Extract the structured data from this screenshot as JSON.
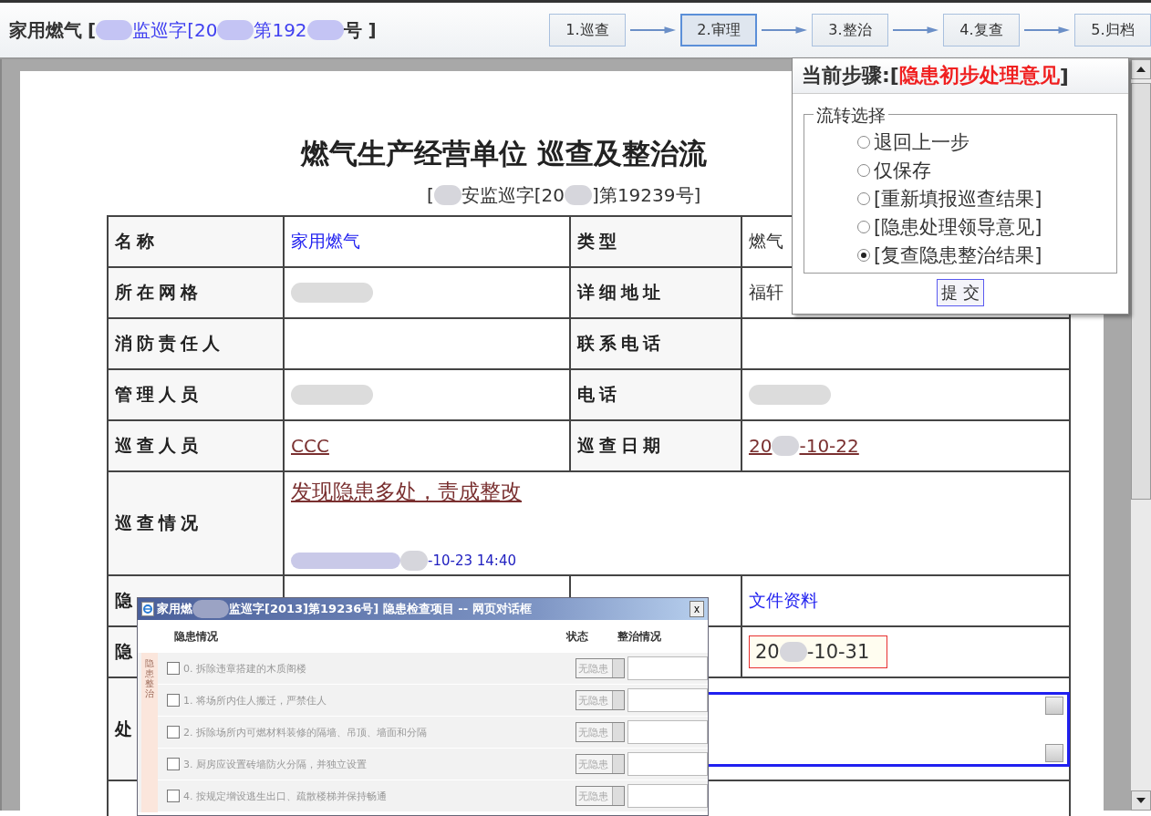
{
  "header": {
    "title": "家用燃气",
    "ref_parts": [
      "[",
      "监巡字[20",
      "第192",
      "号 ]"
    ]
  },
  "steps": [
    {
      "label": "1.巡查",
      "selected": false
    },
    {
      "label": "2.审理",
      "selected": true
    },
    {
      "label": "3.整治",
      "selected": false
    },
    {
      "label": "4.复查",
      "selected": false
    },
    {
      "label": "5.归档",
      "selected": false
    }
  ],
  "document": {
    "title": "燃气生产经营单位 巡查及整治流",
    "subtitle_parts": [
      "[",
      "安监巡字[20",
      "]第19239号]"
    ],
    "rows": [
      {
        "kind": "pair",
        "cells": [
          {
            "kind": "label",
            "text": "名称"
          },
          {
            "kind": "link",
            "text": "家用燃气"
          },
          {
            "kind": "label",
            "text": "类型"
          },
          {
            "kind": "plain",
            "text": "燃气"
          }
        ]
      },
      {
        "kind": "pair",
        "cells": [
          {
            "kind": "label",
            "text": "所在网格"
          },
          {
            "kind": "redacted"
          },
          {
            "kind": "label",
            "text": "详细地址"
          },
          {
            "kind": "plain",
            "text": "福轩"
          }
        ]
      },
      {
        "kind": "pair",
        "cells": [
          {
            "kind": "label",
            "text": "消防责任人"
          },
          {
            "kind": "empty"
          },
          {
            "kind": "label",
            "text": "联系电话"
          },
          {
            "kind": "empty"
          }
        ]
      },
      {
        "kind": "pair",
        "cells": [
          {
            "kind": "label",
            "text": "管理人员"
          },
          {
            "kind": "redacted"
          },
          {
            "kind": "label",
            "text": "电话"
          },
          {
            "kind": "redacted"
          }
        ]
      },
      {
        "kind": "pair",
        "cells": [
          {
            "kind": "label",
            "text": "巡查人员"
          },
          {
            "kind": "entry",
            "parts": [
              "CCC"
            ]
          },
          {
            "kind": "label",
            "text": "巡查日期"
          },
          {
            "kind": "entry",
            "parts": [
              "20",
              "-10-22"
            ]
          }
        ]
      },
      {
        "kind": "wide",
        "cells": [
          {
            "kind": "label",
            "text": "巡查情况"
          },
          {
            "kind": "note",
            "parts": [
              "发现隐患多处，责成整改"
            ],
            "stamp": "-10-23 14:40"
          }
        ]
      },
      {
        "kind": "pair",
        "cells": [
          {
            "kind": "label",
            "text": "隐"
          },
          {
            "kind": "empty"
          },
          {
            "kind": "empty"
          },
          {
            "kind": "link",
            "text": "文件资料"
          }
        ]
      },
      {
        "kind": "pair",
        "cells": [
          {
            "kind": "label",
            "text": "隐"
          },
          {
            "kind": "empty"
          },
          {
            "kind": "empty"
          },
          {
            "kind": "date-field",
            "parts": [
              "20",
              "-10-31"
            ]
          }
        ]
      },
      {
        "kind": "tall",
        "cells": [
          {
            "kind": "label",
            "text": "处"
          },
          {
            "kind": "textarea"
          }
        ]
      },
      {
        "kind": "wide",
        "cells": [
          {
            "kind": "empty"
          },
          {
            "kind": "empty"
          }
        ]
      }
    ]
  },
  "flow_panel": {
    "step_label": "当前步骤:[",
    "step_name": "隐患初步处理意见",
    "step_suffix": "]",
    "legend": "流转选择",
    "options": [
      {
        "label": "退回上一步",
        "selected": false
      },
      {
        "label": "仅保存",
        "selected": false
      },
      {
        "label": "[重新填报巡查结果]",
        "selected": false
      },
      {
        "label": "[隐患处理领导意见]",
        "selected": false
      },
      {
        "label": "[复查隐患整治结果]",
        "selected": true
      }
    ],
    "submit": "提 交"
  },
  "dialog": {
    "title_parts": [
      "家用燃",
      "监巡字[2013]第19236号] 隐患检查项目 -- 网页对话框"
    ],
    "close": "x",
    "columns": [
      "隐患情况",
      "状态",
      "整治情况"
    ],
    "group_label": "隐患整治",
    "items": [
      {
        "text": "0. 拆除违章搭建的木质阁楼",
        "checked": false,
        "status": "无隐患",
        "disabled": true
      },
      {
        "text": "1. 将场所内住人搬迁，严禁住人",
        "checked": false,
        "status": "无隐患",
        "disabled": true
      },
      {
        "text": "2. 拆除场所内可燃材料装修的隔墙、吊顶、墙面和分隔",
        "checked": false,
        "status": "无隐患",
        "disabled": true
      },
      {
        "text": "3. 厨房应设置砖墙防火分隔，并独立设置",
        "checked": false,
        "status": "无隐患",
        "disabled": true
      },
      {
        "text": "4. 按规定增设逃生出口、疏散楼梯并保持畅通",
        "checked": false,
        "status": "无隐患",
        "disabled": true
      }
    ]
  }
}
